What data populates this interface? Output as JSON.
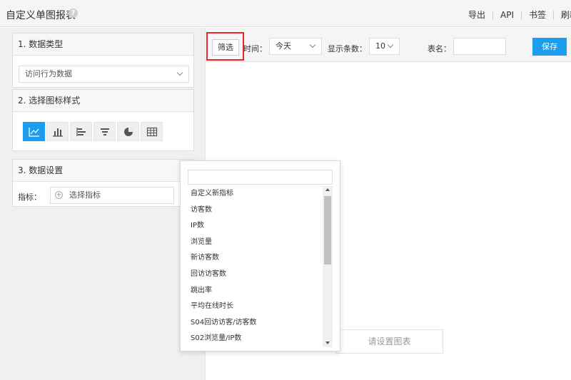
{
  "header": {
    "title": "自定义单图报表",
    "help_icon": "question-icon",
    "help_glyph": "?",
    "actions": [
      "导出",
      "API",
      "书签",
      "刷新"
    ]
  },
  "sidebar": {
    "panel_data_type": {
      "heading": "1. 数据类型",
      "selected": "访问行为数据"
    },
    "panel_chart_style": {
      "heading": "2. 选择图标样式",
      "types": [
        {
          "icon": "line-chart-icon",
          "active": true
        },
        {
          "icon": "bar-chart-icon",
          "active": false
        },
        {
          "icon": "horizontal-bar-chart-icon",
          "active": false
        },
        {
          "icon": "funnel-chart-icon",
          "active": false
        },
        {
          "icon": "pie-chart-icon",
          "active": false
        },
        {
          "icon": "table-icon",
          "active": false
        }
      ]
    },
    "panel_data_settings": {
      "heading": "3. 数据设置",
      "metric_label": "指标：",
      "metric_placeholder": "选择指标"
    }
  },
  "toolbar": {
    "filter_label": "筛选",
    "time_label": "时间：",
    "time_value": "今天",
    "rows_label": "显示条数：",
    "rows_value": "10",
    "table_name_label": "表名：",
    "table_name_value": "",
    "save_label": "保存"
  },
  "canvas": {
    "set_chart_label": "请设置图表"
  },
  "metric_dropdown": {
    "search_value": "",
    "items": [
      "自定义新指标",
      "访客数",
      "IP数",
      "浏览量",
      "新访客数",
      "回访访客数",
      "跳出率",
      "平均在线时长",
      "S04回访访客/访客数",
      "S02浏览量/IP数"
    ]
  },
  "colors": {
    "accent": "#1c9ded",
    "highlight": "#e8262c"
  }
}
